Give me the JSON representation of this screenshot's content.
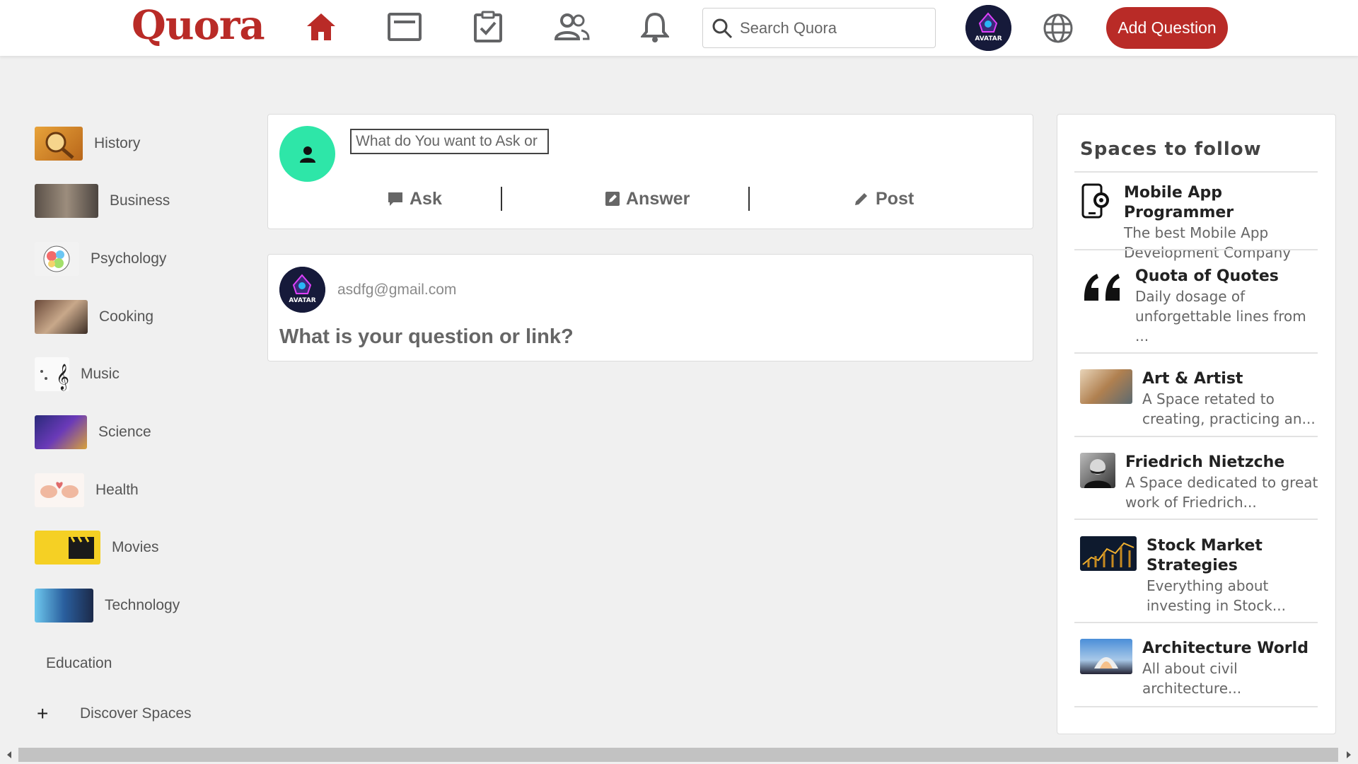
{
  "header": {
    "logo": "Quora",
    "search_placeholder": "Search Quora",
    "add_question": "Add Question",
    "avatar_text": "AVATAR",
    "nav_icons": [
      "home-icon",
      "following-icon",
      "answer-icon",
      "spaces-icon",
      "notifications-icon"
    ]
  },
  "sidebar": {
    "items": [
      {
        "label": "History"
      },
      {
        "label": "Business"
      },
      {
        "label": "Psychology"
      },
      {
        "label": "Cooking"
      },
      {
        "label": "Music"
      },
      {
        "label": "Science"
      },
      {
        "label": "Health"
      },
      {
        "label": "Movies"
      },
      {
        "label": "Technology"
      },
      {
        "label": "Education"
      }
    ],
    "discover": "Discover Spaces",
    "plus": "+"
  },
  "ask_box": {
    "placeholder": "What do You want to Ask or",
    "ask": "Ask",
    "answer": "Answer",
    "post": "Post"
  },
  "post_box": {
    "email": "asdfg@gmail.com",
    "question": "What is your question or link?"
  },
  "spaces": {
    "title": "Spaces to follow",
    "items": [
      {
        "name": "Mobile App Programmer",
        "desc1": "The best Mobile App",
        "desc2": "Development Company"
      },
      {
        "name": "Quota of Quotes",
        "desc1": "Daily dosage of",
        "desc2": "unforgettable lines from",
        "desc3": "..."
      },
      {
        "name": "Art & Artist",
        "desc1": "A Space retated to",
        "desc2": "creating, practicing an..."
      },
      {
        "name": "Friedrich Nietzche",
        "desc1": "A Space dedicated to great",
        "desc2": "work of Friedrich..."
      },
      {
        "name1": "Stock Market",
        "name2": "Strategies",
        "desc1": "Everything about",
        "desc2": "investing in Stock..."
      },
      {
        "name": "Architecture World",
        "desc1": "All about civil",
        "desc2": "architecture..."
      }
    ]
  },
  "colors": {
    "brand": "#b92b27",
    "ask_avatar": "#2ee6a8",
    "page_bg": "#f0f0f0"
  }
}
